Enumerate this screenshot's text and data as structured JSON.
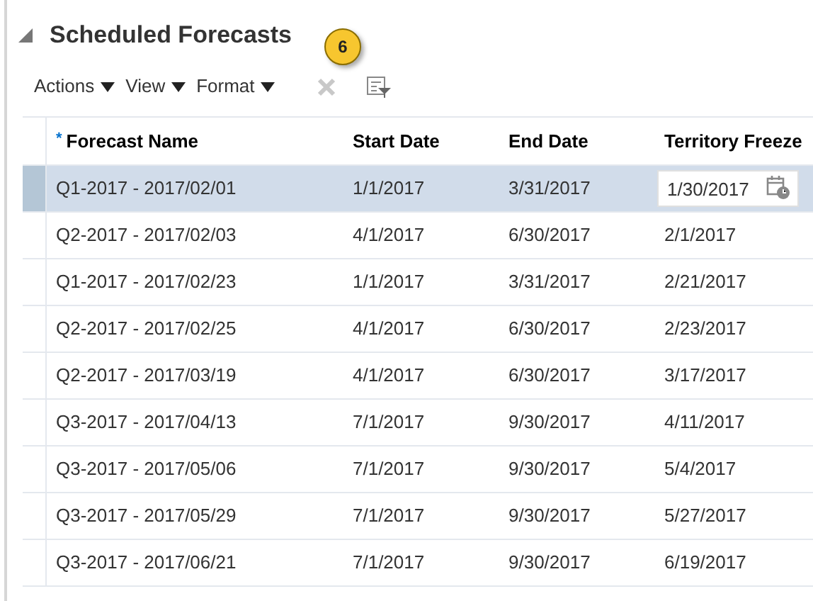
{
  "section": {
    "title": "Scheduled Forecasts",
    "expanded": true
  },
  "callout": "6",
  "toolbar": {
    "menus": [
      "Actions",
      "View",
      "Format"
    ],
    "delete_disabled": true
  },
  "table": {
    "columns": [
      {
        "label": "Forecast Name",
        "required": true,
        "required_mark": "*"
      },
      {
        "label": "Start Date",
        "required": false
      },
      {
        "label": "End Date",
        "required": false
      },
      {
        "label": "Territory Freeze",
        "required": false
      }
    ],
    "rows": [
      {
        "cells": [
          "Q1-2017 - 2017/02/01",
          "1/1/2017",
          "3/31/2017",
          "1/30/2017"
        ],
        "selected": true
      },
      {
        "cells": [
          "Q2-2017 - 2017/02/03",
          "4/1/2017",
          "6/30/2017",
          "2/1/2017"
        ],
        "selected": false
      },
      {
        "cells": [
          "Q1-2017 - 2017/02/23",
          "1/1/2017",
          "3/31/2017",
          "2/21/2017"
        ],
        "selected": false
      },
      {
        "cells": [
          "Q2-2017 - 2017/02/25",
          "4/1/2017",
          "6/30/2017",
          "2/23/2017"
        ],
        "selected": false
      },
      {
        "cells": [
          "Q2-2017 - 2017/03/19",
          "4/1/2017",
          "6/30/2017",
          "3/17/2017"
        ],
        "selected": false
      },
      {
        "cells": [
          "Q3-2017 - 2017/04/13",
          "7/1/2017",
          "9/30/2017",
          "4/11/2017"
        ],
        "selected": false
      },
      {
        "cells": [
          "Q3-2017 - 2017/05/06",
          "7/1/2017",
          "9/30/2017",
          "5/4/2017"
        ],
        "selected": false
      },
      {
        "cells": [
          "Q3-2017 - 2017/05/29",
          "7/1/2017",
          "9/30/2017",
          "5/27/2017"
        ],
        "selected": false
      },
      {
        "cells": [
          "Q3-2017 - 2017/06/21",
          "7/1/2017",
          "9/30/2017",
          "6/19/2017"
        ],
        "selected": false
      }
    ]
  }
}
